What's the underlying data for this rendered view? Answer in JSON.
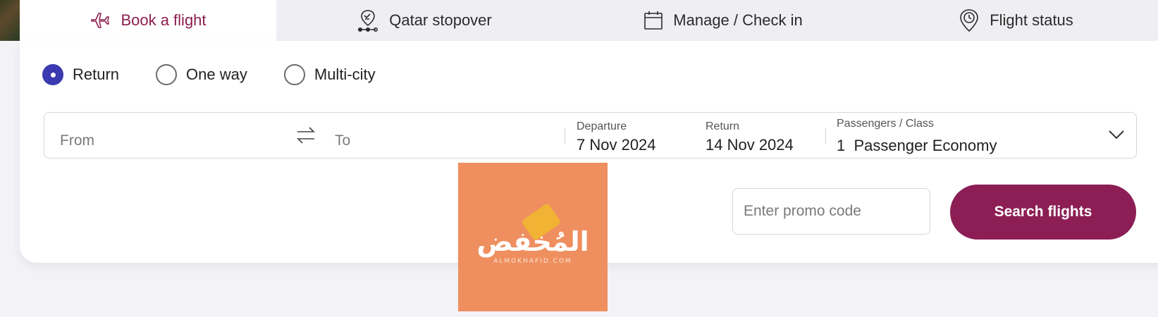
{
  "tabs": [
    {
      "label": "Book a flight",
      "icon": "airplane-icon",
      "active": true
    },
    {
      "label": "Qatar stopover",
      "icon": "map-pin-route-icon",
      "active": false
    },
    {
      "label": "Manage / Check in",
      "icon": "calendar-icon",
      "active": false
    },
    {
      "label": "Flight status",
      "icon": "clock-pin-icon",
      "active": false
    }
  ],
  "trip_type": {
    "options": [
      "Return",
      "One way",
      "Multi-city"
    ],
    "selected": "Return"
  },
  "search": {
    "from_placeholder": "From",
    "to_placeholder": "To",
    "departure_label": "Departure",
    "departure_value": "7 Nov 2024",
    "return_label": "Return",
    "return_value": "14 Nov 2024",
    "passengers_label": "Passengers / Class",
    "passengers_value": "1  Passenger Economy"
  },
  "promo": {
    "placeholder": "Enter promo code",
    "value": ""
  },
  "search_button_label": "Search flights",
  "watermark": {
    "arabic": "المُخفض",
    "latin": "ALMOKHAFID.COM"
  },
  "colors": {
    "brand": "#8c1e55",
    "radio_checked": "#3b3ab0",
    "watermark_bg": "#ef8f5f"
  }
}
